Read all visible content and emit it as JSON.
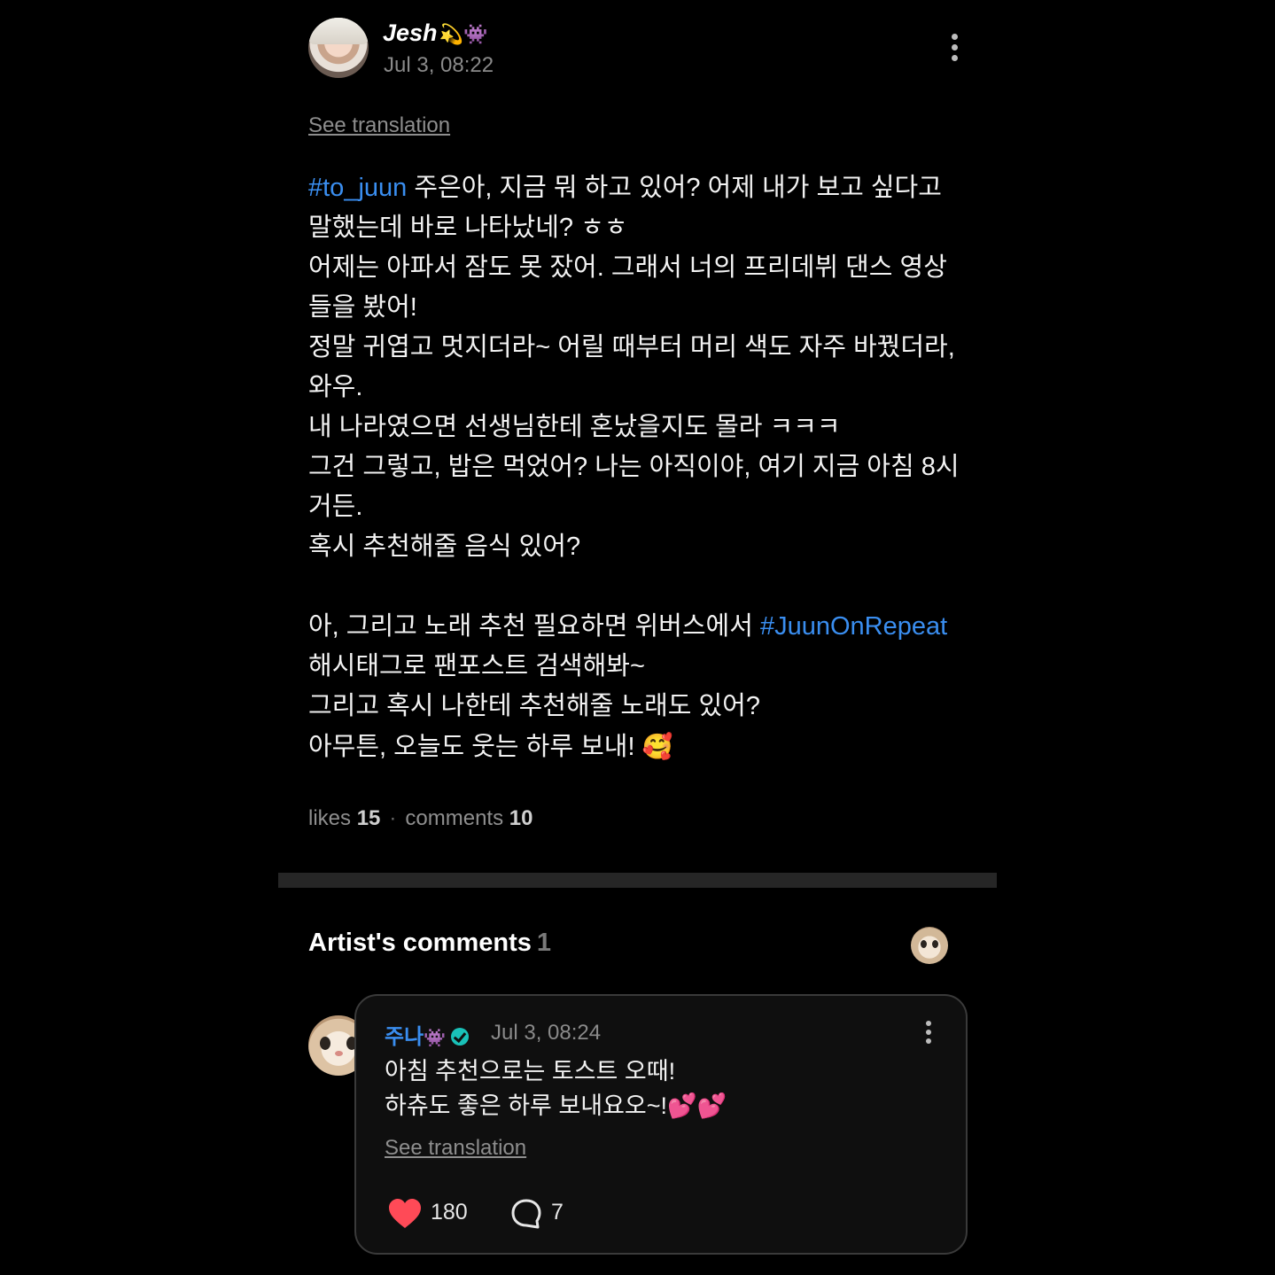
{
  "post": {
    "author": "Jesh",
    "author_emoji": "💫👾",
    "time": "Jul 3, 08:22",
    "see_translation": "See translation",
    "lines": [
      [
        {
          "t": "#to_juun",
          "tag": true
        },
        {
          "t": " 주은아, 지금 뭐 하고 있어? 어제 내가 보고 싶다고"
        }
      ],
      [
        {
          "t": "말했는데 바로 나타났네? ㅎㅎ"
        }
      ],
      [
        {
          "t": "어제는 아파서 잠도 못 잤어. 그래서 너의 프리데뷔 댄스 영상"
        }
      ],
      [
        {
          "t": "들을 봤어!"
        }
      ],
      [
        {
          "t": "정말 귀엽고 멋지더라~ 어릴 때부터 머리 색도 자주 바꿨더라,"
        }
      ],
      [
        {
          "t": "와우."
        }
      ],
      [
        {
          "t": "내 나라였으면 선생님한테 혼났을지도 몰라 ㅋㅋㅋ"
        }
      ],
      [
        {
          "t": "그건 그렇고, 밥은 먹었어? 나는 아직이야, 여기 지금 아침 8시"
        }
      ],
      [
        {
          "t": "거든."
        }
      ],
      [
        {
          "t": "혹시 추천해줄 음식 있어?"
        }
      ],
      [],
      [
        {
          "t": "아, 그리고 노래 추천 필요하면 위버스에서 "
        },
        {
          "t": "#JuunOnRepeat",
          "tag": true
        }
      ],
      [
        {
          "t": "해시태그로 팬포스트 검색해봐~"
        }
      ],
      [
        {
          "t": "그리고 혹시 나한테 추천해줄 노래도 있어?"
        }
      ],
      [
        {
          "t": "아무튼, 오늘도 웃는 하루 보내! "
        },
        {
          "t": "🥰",
          "emoji": true
        }
      ]
    ],
    "likes_label": "likes",
    "likes_count": "15",
    "comments_label": "comments",
    "comments_count": "10",
    "separator": "·"
  },
  "artist_comments": {
    "title": "Artist's comments",
    "count": "1"
  },
  "comment": {
    "author": "주나",
    "author_emoji": "👾",
    "time": "Jul 3, 08:24",
    "lines": [
      "아침 추천으로는 토스트 오때!",
      "하츄도 좋은 하루 보내요오~!💕💕"
    ],
    "see_translation": "See translation",
    "likes": "180",
    "replies": "7"
  },
  "colors": {
    "background": "#000000",
    "hashtag": "#3a8ef0",
    "heart": "#ff4a57",
    "verified": "#19c1b8",
    "divider": "#262626"
  },
  "icons": [
    "more-vertical-icon",
    "verified-badge-icon",
    "heart-icon",
    "reply-bubble-icon"
  ]
}
